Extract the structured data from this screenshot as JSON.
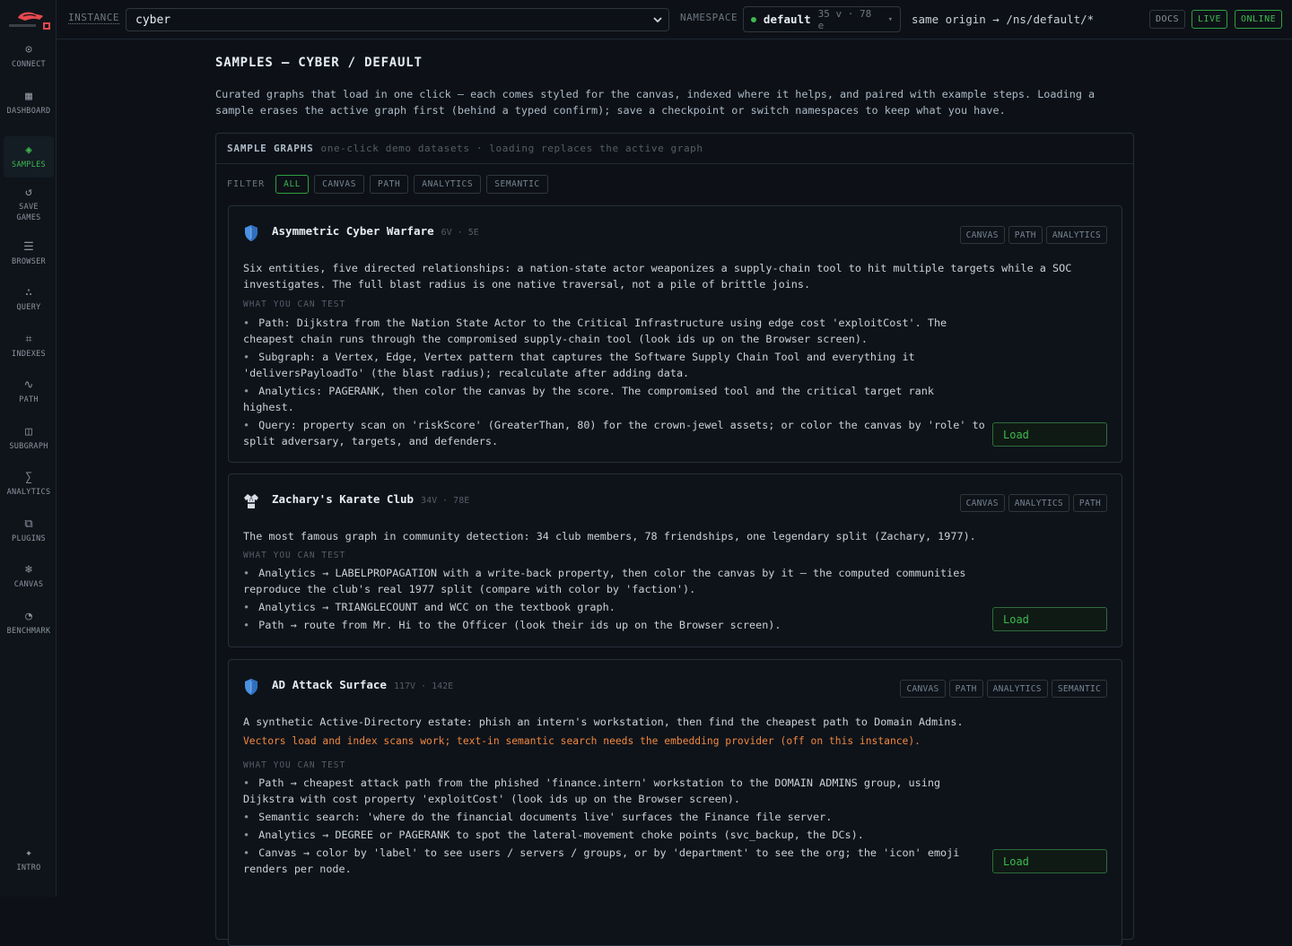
{
  "sidebar": {
    "items": [
      {
        "label": "CONNECT",
        "icon": "connect-icon",
        "glyph": "⊙"
      },
      {
        "label": "DASHBOARD",
        "icon": "dashboard-icon",
        "glyph": "▦"
      },
      {
        "label": "SAMPLES",
        "icon": "samples-icon",
        "glyph": "◈"
      },
      {
        "label": "SAVE GAMES",
        "icon": "save-games-icon",
        "glyph": "↺"
      },
      {
        "label": "BROWSER",
        "icon": "browser-icon",
        "glyph": "☰"
      },
      {
        "label": "QUERY",
        "icon": "query-icon",
        "glyph": "∴"
      },
      {
        "label": "INDEXES",
        "icon": "indexes-icon",
        "glyph": "⌗"
      },
      {
        "label": "PATH",
        "icon": "path-icon",
        "glyph": "∿"
      },
      {
        "label": "SUBGRAPH",
        "icon": "subgraph-icon",
        "glyph": "◫"
      },
      {
        "label": "ANALYTICS",
        "icon": "analytics-icon",
        "glyph": "∑"
      },
      {
        "label": "PLUGINS",
        "icon": "plugins-icon",
        "glyph": "⧉"
      },
      {
        "label": "CANVAS",
        "icon": "canvas-icon",
        "glyph": "❄"
      },
      {
        "label": "BENCHMARK",
        "icon": "benchmark-icon",
        "glyph": "◔"
      }
    ],
    "intro": {
      "label": "INTRO",
      "icon": "intro-icon",
      "glyph": "✦"
    }
  },
  "topbar": {
    "instance_label": "INSTANCE",
    "instance_value": "cyber",
    "namespace_label": "NAMESPACE",
    "namespace_name": "default",
    "namespace_meta": "35 v · 78 e",
    "route": "same origin → /ns/default/*",
    "docs": "DOCS",
    "live": "LIVE",
    "online": "ONLINE"
  },
  "page": {
    "title": "SAMPLES  — CYBER / DEFAULT",
    "description": "Curated graphs that load in one click — each comes styled for the canvas, indexed where it helps, and paired with example steps. Loading a sample erases the active graph first (behind a typed confirm); save a checkpoint or switch namespaces to keep what you have."
  },
  "panel": {
    "title": "SAMPLE GRAPHS",
    "subtitle": "one-click demo datasets · loading replaces the active graph",
    "filter_label": "FILTER",
    "filters": [
      "ALL",
      "CANVAS",
      "PATH",
      "ANALYTICS",
      "SEMANTIC"
    ],
    "active_filter": "ALL"
  },
  "samples": [
    {
      "title": "Asymmetric Cyber Warfare",
      "counts": "6V · 5E",
      "icon": "shield-icon",
      "tags": [
        "CANVAS",
        "PATH",
        "ANALYTICS"
      ],
      "description": "Six entities, five directed relationships: a nation-state actor weaponizes a supply-chain tool to hit multiple targets while a SOC investigates. The full blast radius is one native traversal, not a pile of brittle joins.",
      "warning": "",
      "what_label": "WHAT YOU CAN TEST",
      "bullets": [
        "Path: Dijkstra from the Nation State Actor to the Critical Infrastructure using edge cost 'exploitCost'. The cheapest chain runs through the compromised supply-chain tool (look ids up on the Browser screen).",
        "Subgraph: a Vertex, Edge, Vertex pattern that captures the Software Supply Chain Tool and everything it 'deliversPayloadTo' (the blast radius); recalculate after adding data.",
        "Analytics: PAGERANK, then color the canvas by the score. The compromised tool and the critical target rank highest.",
        "Query: property scan on 'riskScore' (GreaterThan, 80) for the crown-jewel assets; or color the canvas by 'role' to split adversary, targets, and defenders."
      ],
      "load_label": "Load"
    },
    {
      "title": "Zachary's Karate Club",
      "counts": "34V · 78E",
      "icon": "karate-gi-icon",
      "tags": [
        "CANVAS",
        "ANALYTICS",
        "PATH"
      ],
      "description": "The most famous graph in community detection: 34 club members, 78 friendships, one legendary split (Zachary, 1977).",
      "warning": "",
      "what_label": "WHAT YOU CAN TEST",
      "bullets": [
        "Analytics → LABELPROPAGATION with a write-back property, then color the canvas by it — the computed communities reproduce the club's real 1977 split (compare with color by 'faction').",
        "Analytics → TRIANGLECOUNT and WCC on the textbook graph.",
        "Path → route from Mr. Hi to the Officer (look their ids up on the Browser screen)."
      ],
      "load_label": "Load"
    },
    {
      "title": "AD Attack Surface",
      "counts": "117V · 142E",
      "icon": "shield-icon",
      "tags": [
        "CANVAS",
        "PATH",
        "ANALYTICS",
        "SEMANTIC"
      ],
      "description": "A synthetic Active-Directory estate: phish an intern's workstation, then find the cheapest path to Domain Admins.",
      "warning": "Vectors load and index scans work; text-in semantic search needs the embedding provider (off on this instance).",
      "what_label": "WHAT YOU CAN TEST",
      "bullets": [
        "Path → cheapest attack path from the phished 'finance.intern' workstation to the DOMAIN ADMINS group, using Dijkstra with cost property 'exploitCost' (look ids up on the Browser screen).",
        "Semantic search: 'where do the financial documents live' surfaces the Finance file server.",
        "Analytics → DEGREE or PAGERANK to spot the lateral-movement choke points (svc_backup, the DCs).",
        "Canvas → color by 'label' to see users / servers / groups, or by 'department' to see the org; the 'icon' emoji renders per node."
      ],
      "load_label": "Load"
    }
  ],
  "colors": {
    "accent": "#3fb950",
    "warning": "#f0883e",
    "background": "#0d1117",
    "logo_red": "#e5484d"
  }
}
